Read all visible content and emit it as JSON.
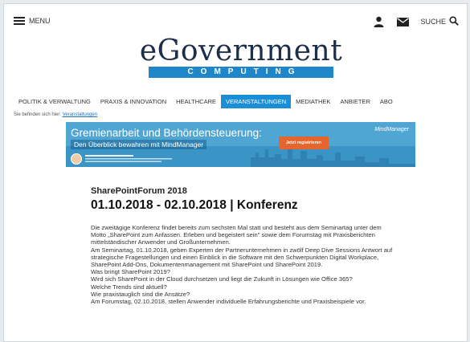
{
  "header": {
    "menu_label": "MENU",
    "search_label": "SUCHE"
  },
  "logo": {
    "main": "eGovernment",
    "sub": "COMPUTING"
  },
  "nav": [
    {
      "label": "POLITIK & VERWALTUNG",
      "active": false
    },
    {
      "label": "PRAXIS & INNOVATION",
      "active": false
    },
    {
      "label": "HEALTHCARE",
      "active": false
    },
    {
      "label": "VERANSTALTUNGEN",
      "active": true
    },
    {
      "label": "MEDIATHEK",
      "active": false
    },
    {
      "label": "ANBIETER",
      "active": false
    },
    {
      "label": "ABO",
      "active": false
    }
  ],
  "breadcrumb": {
    "prefix": "Sie befinden sich hier:",
    "link": "Veranstaltungen"
  },
  "banner": {
    "title": "Gremienarbeit und Behördensteuerung:",
    "subtitle": "Den Überblick bewahren mit MindManager",
    "cta": "Jetzt registrieren",
    "brand": "MindManager"
  },
  "article": {
    "kicker": "SharePointForum 2018",
    "headline": "01.10.2018 - 02.10.2018 | Konferenz",
    "paragraphs": [
      "Die zweitägige Konferenz findet bereits zum sechsten Mal statt und besteht aus dem Seminartag unter dem Motto „SharePoint zum Anfassen. Erleben und begeistert sein\" sowie dem Forumstag mit Praxisberichten mittelständischer Anwender und Großunternehmen.",
      "Am Seminartag, 01.10.2018, geben Experten der Partnerunternehmen in zwölf Deep Dive Sessions Antwort auf strategische Fragestellungen und einen Einblick in die Software mit den Schwerpunkten Digital Workplace, SharePoint Add-Ons, Dokumentenmanagement mit SharePoint und SharePoint 2019.",
      "Was bringt SharePoint 2019?",
      "Wird sich SharePoint in der Cloud durchsetzen und liegt die Zukunft in Lösungen wie Office 365?",
      "Welche Trends sind aktuell?",
      "Wie praxistauglich sind die Ansätze?",
      "Am Forumstag, 02.10.2018, stellen Anwender individuelle Erfahrungsberichte und Praxisbeispiele vor."
    ]
  },
  "colors": {
    "accent": "#1a8fd6",
    "logo_navy": "#1d2f48",
    "banner_blue": "#5aaed8",
    "cta_orange": "#e4652e"
  }
}
